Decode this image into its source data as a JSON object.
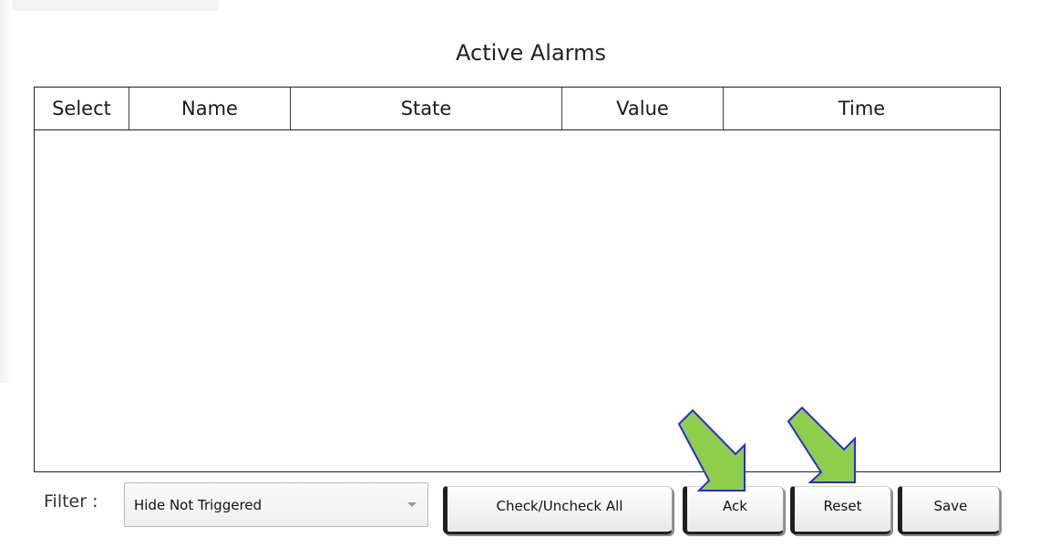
{
  "panel": {
    "title": "Active Alarms"
  },
  "table": {
    "columns": [
      "Select",
      "Name",
      "State",
      "Value",
      "Time"
    ],
    "rows": []
  },
  "filter": {
    "label": "Filter :",
    "selected": "Hide Not Triggered"
  },
  "buttons": {
    "check_all": "Check/Uncheck All",
    "ack": "Ack",
    "reset": "Reset",
    "save": "Save"
  },
  "annotations": {
    "arrow_color": "#8fce4a",
    "arrow_outline": "#2a2ad8",
    "icon": "arrow-down-right-icon"
  }
}
